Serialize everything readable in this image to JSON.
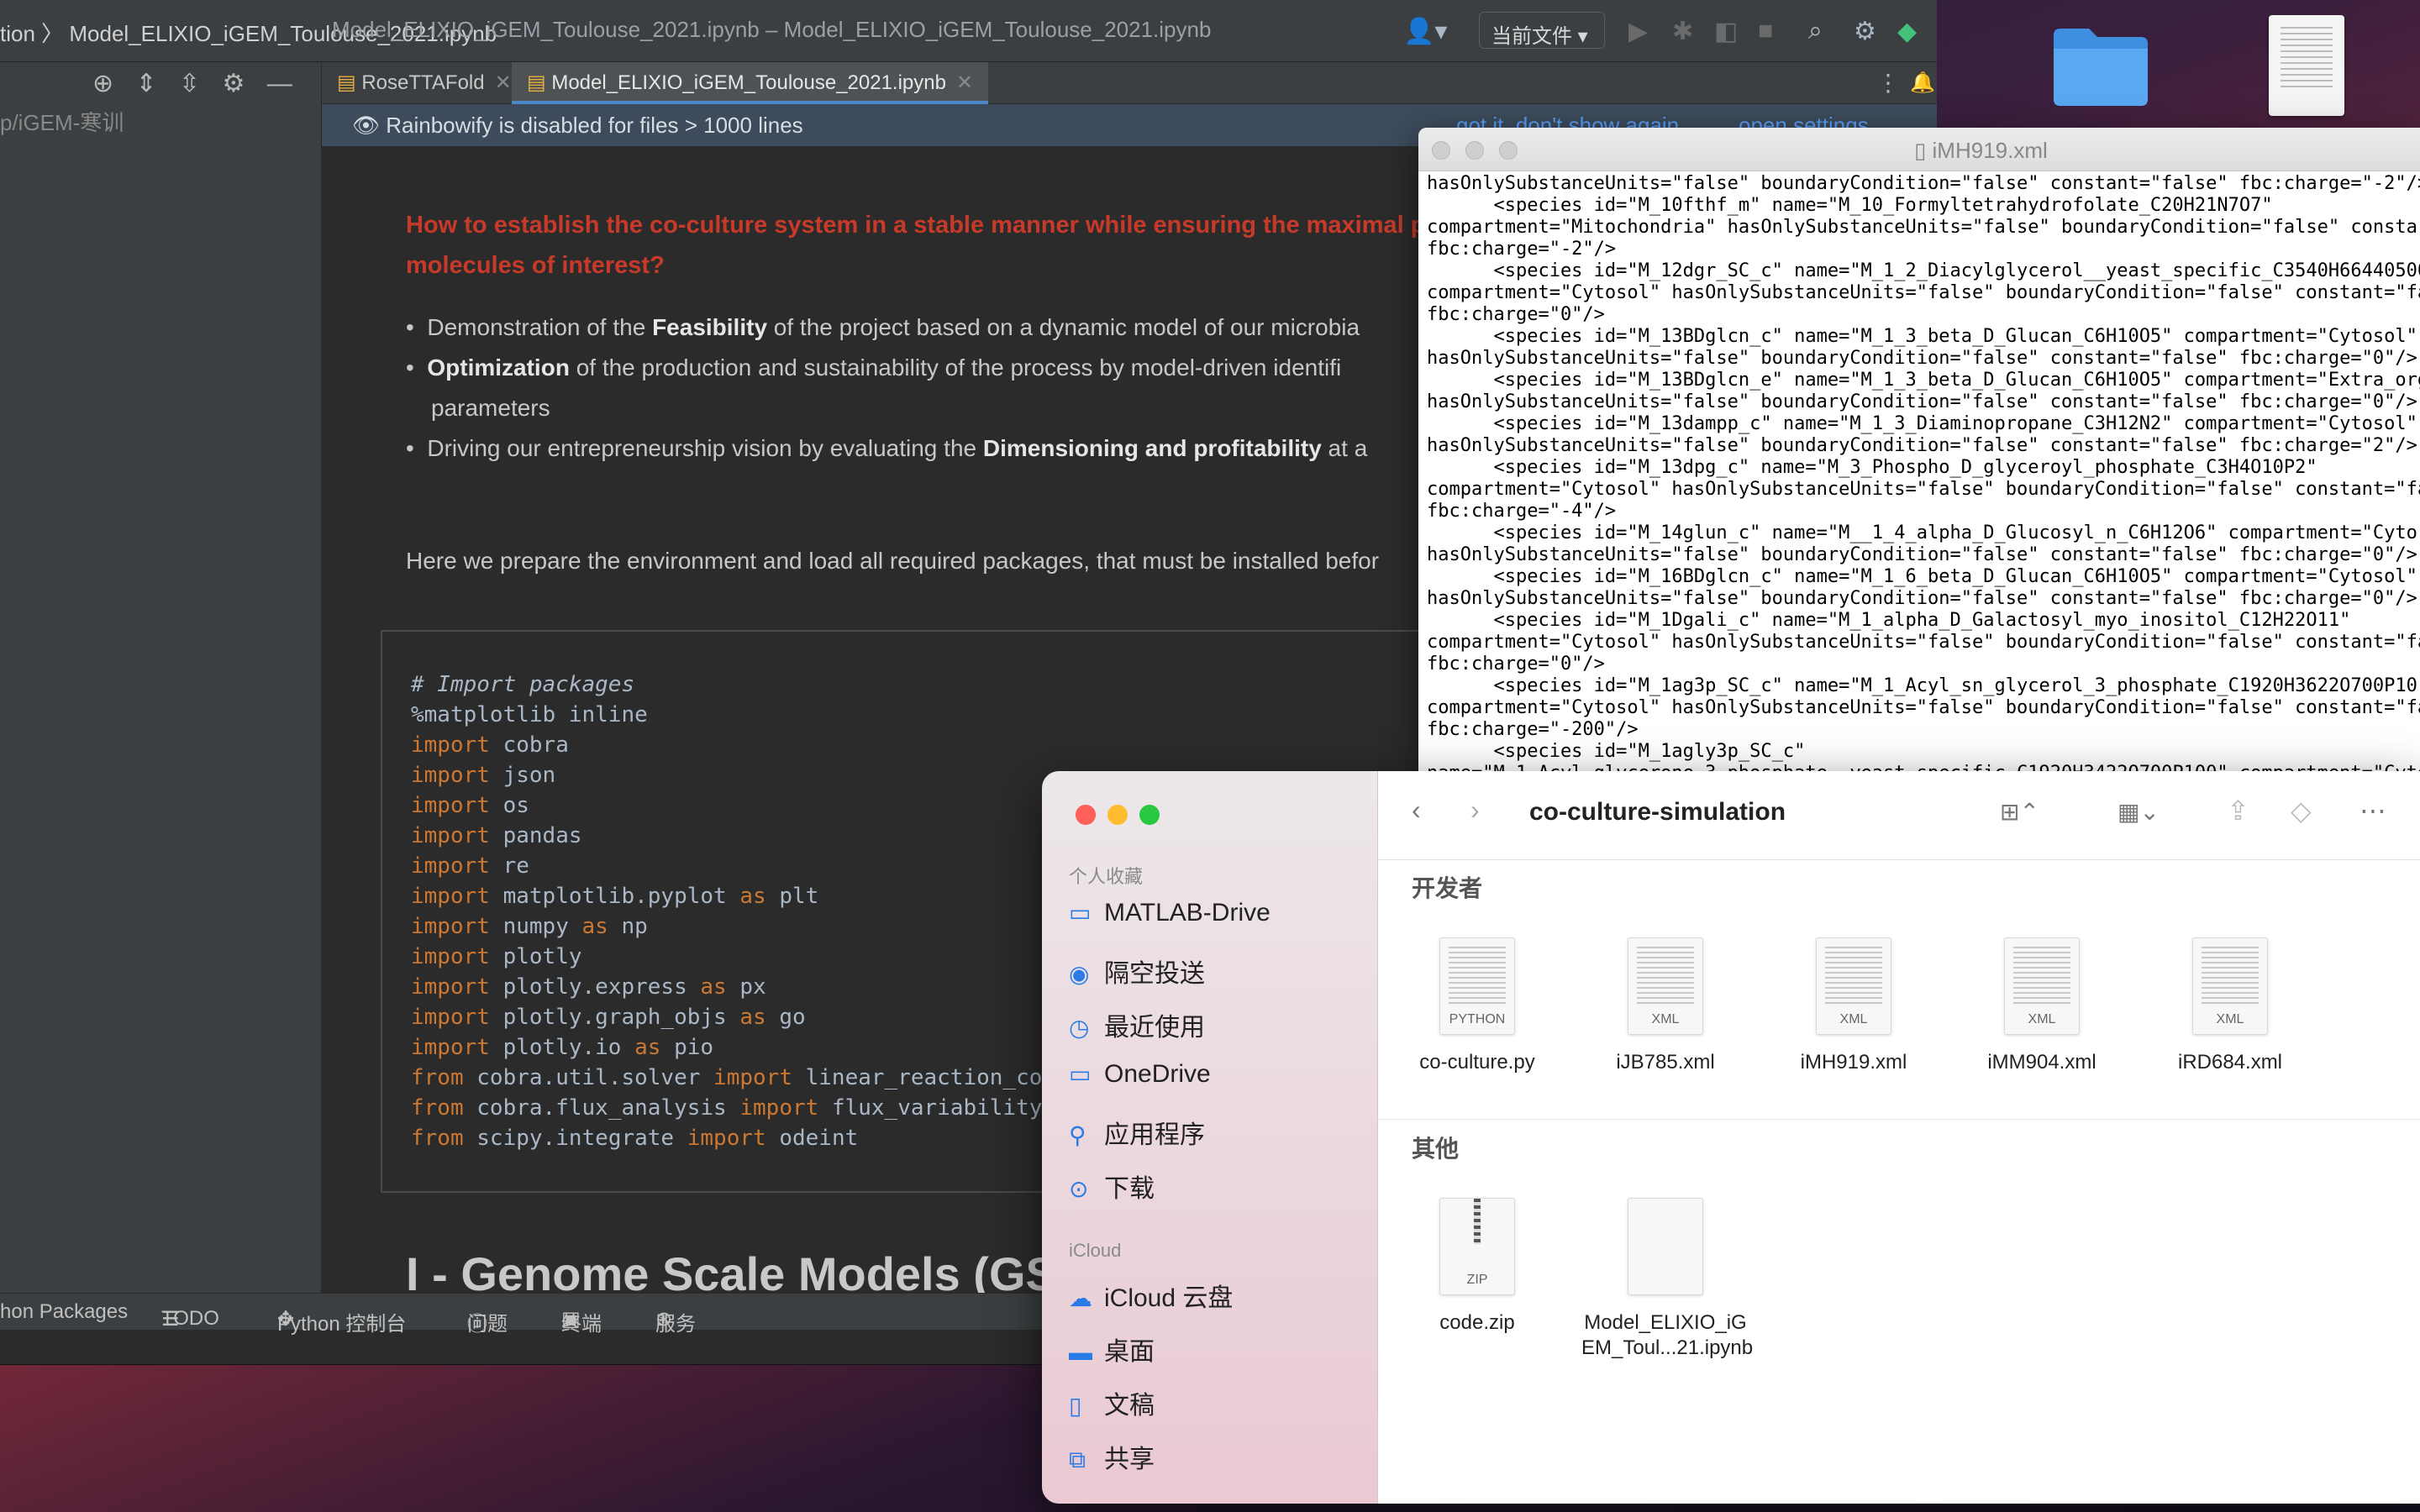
{
  "desktop": {
    "folder_icon": "folder-icon",
    "file_icon": "csv-file-icon"
  },
  "ide": {
    "breadcrumb": "tion 〉 Model_ELIXIO_iGEM_Toulouse_2021.ipynb",
    "title": "Model_ELIXIO_iGEM_Toulouse_2021.ipynb – Model_ELIXIO_iGEM_Toulouse_2021.ipynb",
    "scope_select": "当前文件 ▾",
    "project_path": "p/iGEM-寒训",
    "tabs": [
      {
        "label": "RoseTTAFold"
      },
      {
        "label": "Model_ELIXIO_iGEM_Toulouse_2021.ipynb"
      }
    ],
    "notice": {
      "text": "Rainbowify is disabled for files > 1000 lines",
      "link1": "got it, don't show again",
      "link2": "open settings"
    },
    "notebook": {
      "question_line1": "How to establish the co-culture system in a stable manner while ensuring the maximal p",
      "question_line2": "molecules of interest?",
      "bullet1_pre": "Demonstration of the ",
      "bullet1_bold": "Feasibility",
      "bullet1_post": " of the project based on a dynamic model of our microbia",
      "bullet2_bold": "Optimization",
      "bullet2_post": " of the production and sustainability of the process by model-driven identifi",
      "bullet2_cont": "parameters",
      "bullet3_pre": "Driving our entrepreneurship vision by evaluating the ",
      "bullet3_bold": "Dimensioning and profitability",
      "bullet3_post": " at a",
      "para": "Here we prepare the environment and load all required packages, that must be installed befor",
      "heading": "I - Genome Scale Models (GS"
    },
    "code": {
      "comment": "# Import packages",
      "magic": "%matplotlib inline",
      "kw_import": "import",
      "kw_as": "as",
      "kw_from": "from",
      "mods": [
        "cobra",
        "json",
        "os",
        "pandas",
        "re",
        "matplotlib.pyplot",
        "numpy",
        "plotly",
        "plotly.express",
        "plotly.graph_objs",
        "plotly.io"
      ],
      "aliases": {
        "plt": "plt",
        "np": "np",
        "px": "px",
        "go": "go",
        "pio": "pio"
      },
      "from1_mod": "cobra.util.solver",
      "from1_name": "linear_reaction_coe",
      "from2_mod": "cobra.flux_analysis",
      "from2_name": "flux_variability_",
      "from3_mod": "scipy.integrate",
      "from3_name": "odeint"
    },
    "status": {
      "packages": "hon Packages",
      "todo": "TODO",
      "python_console": "Python 控制台",
      "problems": "问题",
      "terminal": "终端",
      "services": "服务"
    }
  },
  "xml": {
    "title": "iMH919.xml",
    "lines": [
      "hasOnlySubstanceUnits=\"false\" boundaryCondition=\"false\" constant=\"false\" fbc:charge=\"-2\"/>",
      "      <species id=\"M_10fthf_m\" name=\"M_10_Formyltetrahydrofolate_C20H21N7O7\"",
      "compartment=\"Mitochondria\" hasOnlySubstanceUnits=\"false\" boundaryCondition=\"false\" consta",
      "fbc:charge=\"-2\"/>",
      "      <species id=\"M_12dgr_SC_c\" name=\"M_1_2_Diacylglycerol__yeast_specific_C3540H66440500",
      "compartment=\"Cytosol\" hasOnlySubstanceUnits=\"false\" boundaryCondition=\"false\" constant=\"fa",
      "fbc:charge=\"0\"/>",
      "      <species id=\"M_13BDglcn_c\" name=\"M_1_3_beta_D_Glucan_C6H10O5\" compartment=\"Cytosol\"",
      "hasOnlySubstanceUnits=\"false\" boundaryCondition=\"false\" constant=\"false\" fbc:charge=\"0\"/>",
      "      <species id=\"M_13BDglcn_e\" name=\"M_1_3_beta_D_Glucan_C6H10O5\" compartment=\"Extra_org",
      "hasOnlySubstanceUnits=\"false\" boundaryCondition=\"false\" constant=\"false\" fbc:charge=\"0\"/>",
      "      <species id=\"M_13dampp_c\" name=\"M_1_3_Diaminopropane_C3H12N2\" compartment=\"Cytosol\"",
      "hasOnlySubstanceUnits=\"false\" boundaryCondition=\"false\" constant=\"false\" fbc:charge=\"2\"/>",
      "      <species id=\"M_13dpg_c\" name=\"M_3_Phospho_D_glyceroyl_phosphate_C3H4O10P2\"",
      "compartment=\"Cytosol\" hasOnlySubstanceUnits=\"false\" boundaryCondition=\"false\" constant=\"fa",
      "fbc:charge=\"-4\"/>",
      "      <species id=\"M_14glun_c\" name=\"M__1_4_alpha_D_Glucosyl_n_C6H12O6\" compartment=\"Cyto",
      "hasOnlySubstanceUnits=\"false\" boundaryCondition=\"false\" constant=\"false\" fbc:charge=\"0\"/>",
      "      <species id=\"M_16BDglcn_c\" name=\"M_1_6_beta_D_Glucan_C6H10O5\" compartment=\"Cytosol\"",
      "hasOnlySubstanceUnits=\"false\" boundaryCondition=\"false\" constant=\"false\" fbc:charge=\"0\"/>",
      "      <species id=\"M_1Dgali_c\" name=\"M_1_alpha_D_Galactosyl_myo_inositol_C12H22O11\"",
      "compartment=\"Cytosol\" hasOnlySubstanceUnits=\"false\" boundaryCondition=\"false\" constant=\"fa",
      "fbc:charge=\"0\"/>",
      "      <species id=\"M_1ag3p_SC_c\" name=\"M_1_Acyl_sn_glycerol_3_phosphate_C1920H3622O700P10",
      "compartment=\"Cytosol\" hasOnlySubstanceUnits=\"false\" boundaryCondition=\"false\" constant=\"fa",
      "fbc:charge=\"-200\"/>",
      "      <species id=\"M_1agly3p_SC_c\"",
      "name=\"M_1_Acyl_glycerone_3_phosphate__yeast_specific_C1920H3422O700P100\" compartment=\"Cyto"
    ]
  },
  "finder": {
    "sidebar": {
      "favorites_header": "个人收藏",
      "favorites": [
        {
          "label": "MATLAB-Drive",
          "icon": "folder-icon"
        },
        {
          "label": "隔空投送",
          "icon": "airdrop-icon"
        },
        {
          "label": "最近使用",
          "icon": "clock-icon"
        },
        {
          "label": "OneDrive",
          "icon": "folder-icon"
        },
        {
          "label": "应用程序",
          "icon": "applications-icon"
        },
        {
          "label": "下载",
          "icon": "download-icon"
        }
      ],
      "icloud_header": "iCloud",
      "icloud": [
        {
          "label": "iCloud 云盘",
          "icon": "cloud-icon"
        },
        {
          "label": "桌面",
          "icon": "desktop-icon"
        },
        {
          "label": "文稿",
          "icon": "document-icon"
        },
        {
          "label": "共享",
          "icon": "shared-folder-icon"
        }
      ]
    },
    "folder_title": "co-culture-simulation",
    "group1": "开发者",
    "group2": "其他",
    "files1": [
      {
        "name": "co-culture.py",
        "tag": "PYTHON"
      },
      {
        "name": "iJB785.xml",
        "tag": "XML"
      },
      {
        "name": "iMH919.xml",
        "tag": "XML"
      },
      {
        "name": "iMM904.xml",
        "tag": "XML"
      },
      {
        "name": "iRD684.xml",
        "tag": "XML"
      }
    ],
    "files2": [
      {
        "name": "code.zip",
        "tag": "ZIP"
      },
      {
        "name": "Model_ELIXIO_iG EM_Toul...21.ipynb",
        "tag": ""
      }
    ]
  }
}
